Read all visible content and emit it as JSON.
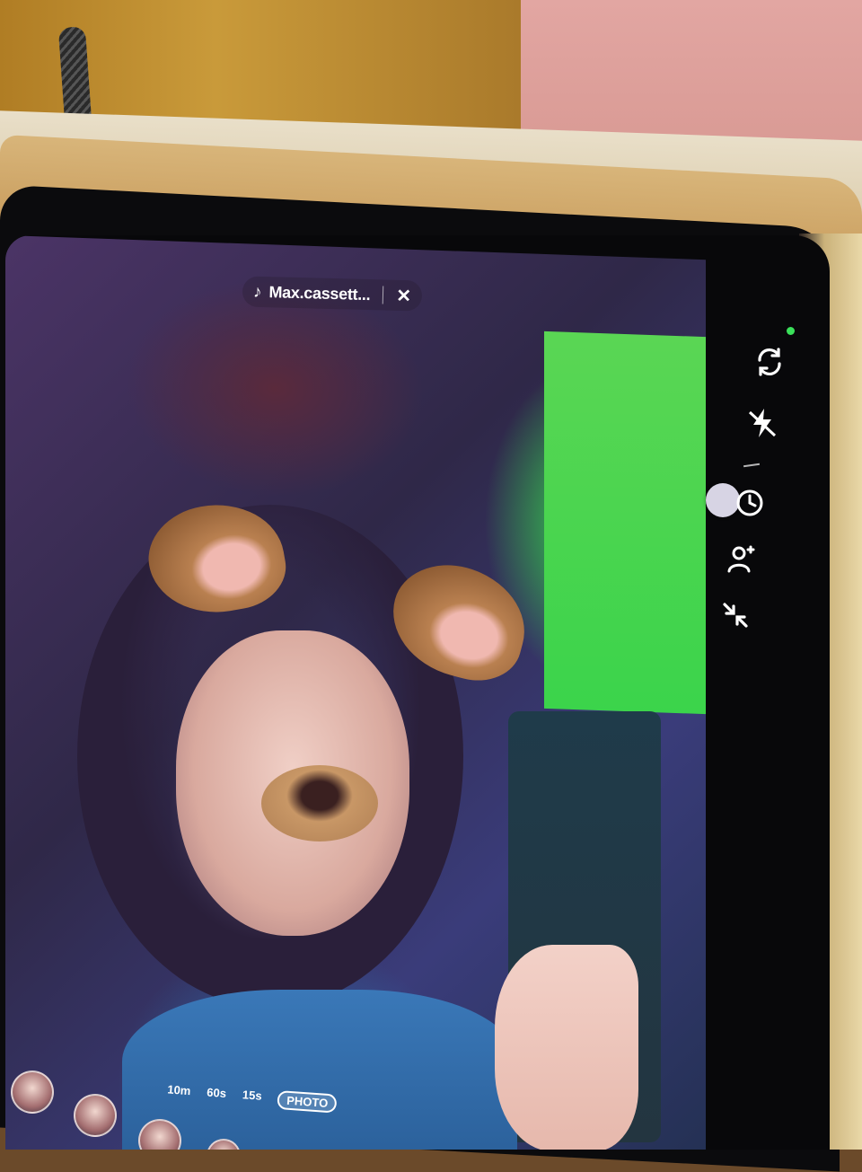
{
  "music": {
    "icon": "music-note-icon",
    "title": "Max.cassett...",
    "close_icon": "close-icon"
  },
  "toolbar": {
    "status_dot_color": "#3ae05a",
    "items": [
      {
        "name": "flip-camera-icon"
      },
      {
        "name": "flash-off-icon"
      },
      {
        "name": "timer-icon"
      },
      {
        "name": "beauty-icon"
      },
      {
        "name": "collapse-icon"
      }
    ]
  },
  "modes": {
    "items": [
      "10m",
      "60s",
      "15s",
      "PHOTO"
    ],
    "selected": "PHOTO"
  }
}
